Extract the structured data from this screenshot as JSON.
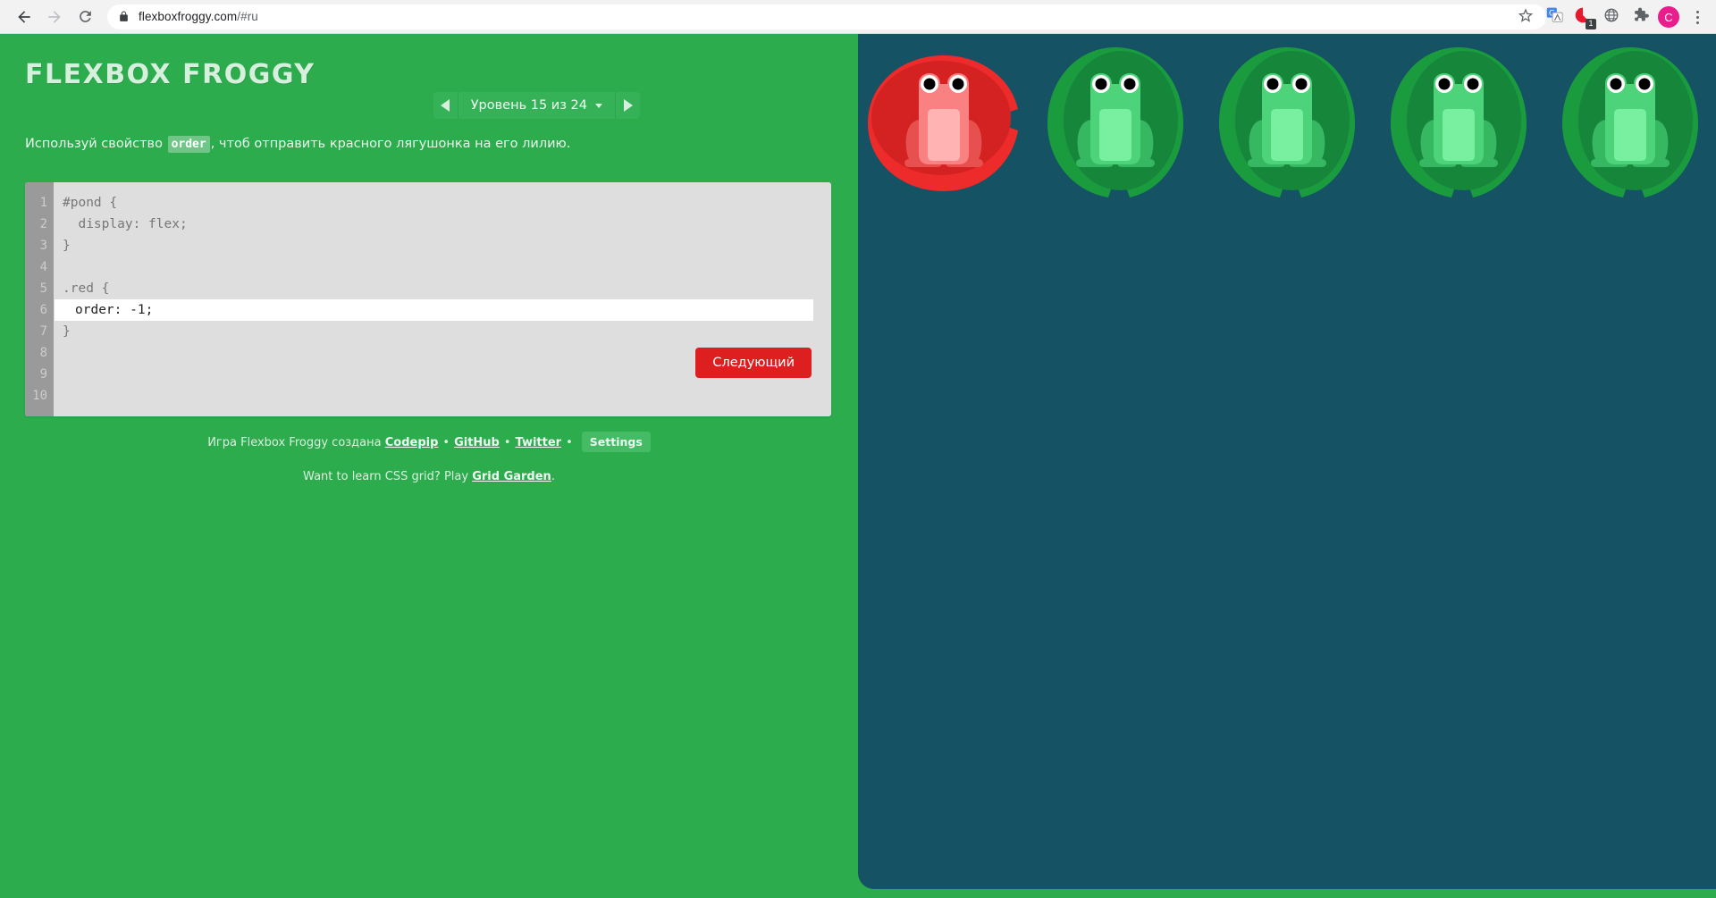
{
  "browser": {
    "back_icon": "back-arrow",
    "forward_icon": "forward-arrow",
    "reload_icon": "reload",
    "lock_icon": "lock",
    "url_main": "flexboxfroggy.com",
    "url_fragment": "/#ru",
    "bookmark_icon": "star",
    "translate_icon": "google-translate",
    "extension_badge": "1",
    "avatar_letter": "C",
    "menu_icon": "three-dot-menu"
  },
  "game": {
    "title": "FLEXBOX FROGGY",
    "level_label": "Уровень 15 из 24",
    "instruction_before": "Используй свойство ",
    "instruction_code": "order",
    "instruction_after": ", чтоб отправить красного лягушонка на его лилию.",
    "next_button": "Следующий",
    "accent_green": "#2cac4d",
    "pond_color": "#155263",
    "next_button_color": "#dd1f1f"
  },
  "editor": {
    "line_numbers": [
      "1",
      "2",
      "3",
      "4",
      "5",
      "6",
      "7",
      "8",
      "9",
      "10"
    ],
    "lines": [
      {
        "text": "#pond {",
        "editable": false
      },
      {
        "text": "  display: flex;",
        "editable": false
      },
      {
        "text": "}",
        "editable": false
      },
      {
        "text": "",
        "editable": false
      },
      {
        "text": ".red {",
        "editable": false
      },
      {
        "text": "order: -1;",
        "editable": true
      },
      {
        "text": "}",
        "editable": false
      }
    ]
  },
  "footer": {
    "credit_prefix": "Игра Flexbox Froggy создана ",
    "link_codepip": "Codepip",
    "link_github": "GitHub",
    "link_twitter": "Twitter",
    "settings_label": "Settings",
    "grid_prefix": "Want to learn CSS grid? Play ",
    "grid_link": "Grid Garden",
    "grid_suffix": "."
  },
  "pond": {
    "frogs": [
      {
        "name": "red-frog",
        "pad_color": "#ee2b2b",
        "pad_shade": "#d42222",
        "frog_body": "#f98181",
        "frog_dark": "#e84f4f",
        "frog_light": "#ffb3b3",
        "pad_rotation": -90
      },
      {
        "name": "green-frog-1",
        "pad_color": "#1a9c3e",
        "pad_shade": "#16863a",
        "frog_body": "#4dd47a",
        "frog_dark": "#36b863",
        "frog_light": "#79f0a0",
        "pad_rotation": 0
      },
      {
        "name": "green-frog-2",
        "pad_color": "#1a9c3e",
        "pad_shade": "#16863a",
        "frog_body": "#4dd47a",
        "frog_dark": "#36b863",
        "frog_light": "#79f0a0",
        "pad_rotation": 0
      },
      {
        "name": "green-frog-3",
        "pad_color": "#1a9c3e",
        "pad_shade": "#16863a",
        "frog_body": "#4dd47a",
        "frog_dark": "#36b863",
        "frog_light": "#79f0a0",
        "pad_rotation": 0
      },
      {
        "name": "green-frog-4",
        "pad_color": "#1a9c3e",
        "pad_shade": "#16863a",
        "frog_body": "#4dd47a",
        "frog_dark": "#36b863",
        "frog_light": "#79f0a0",
        "pad_rotation": 0
      }
    ]
  }
}
